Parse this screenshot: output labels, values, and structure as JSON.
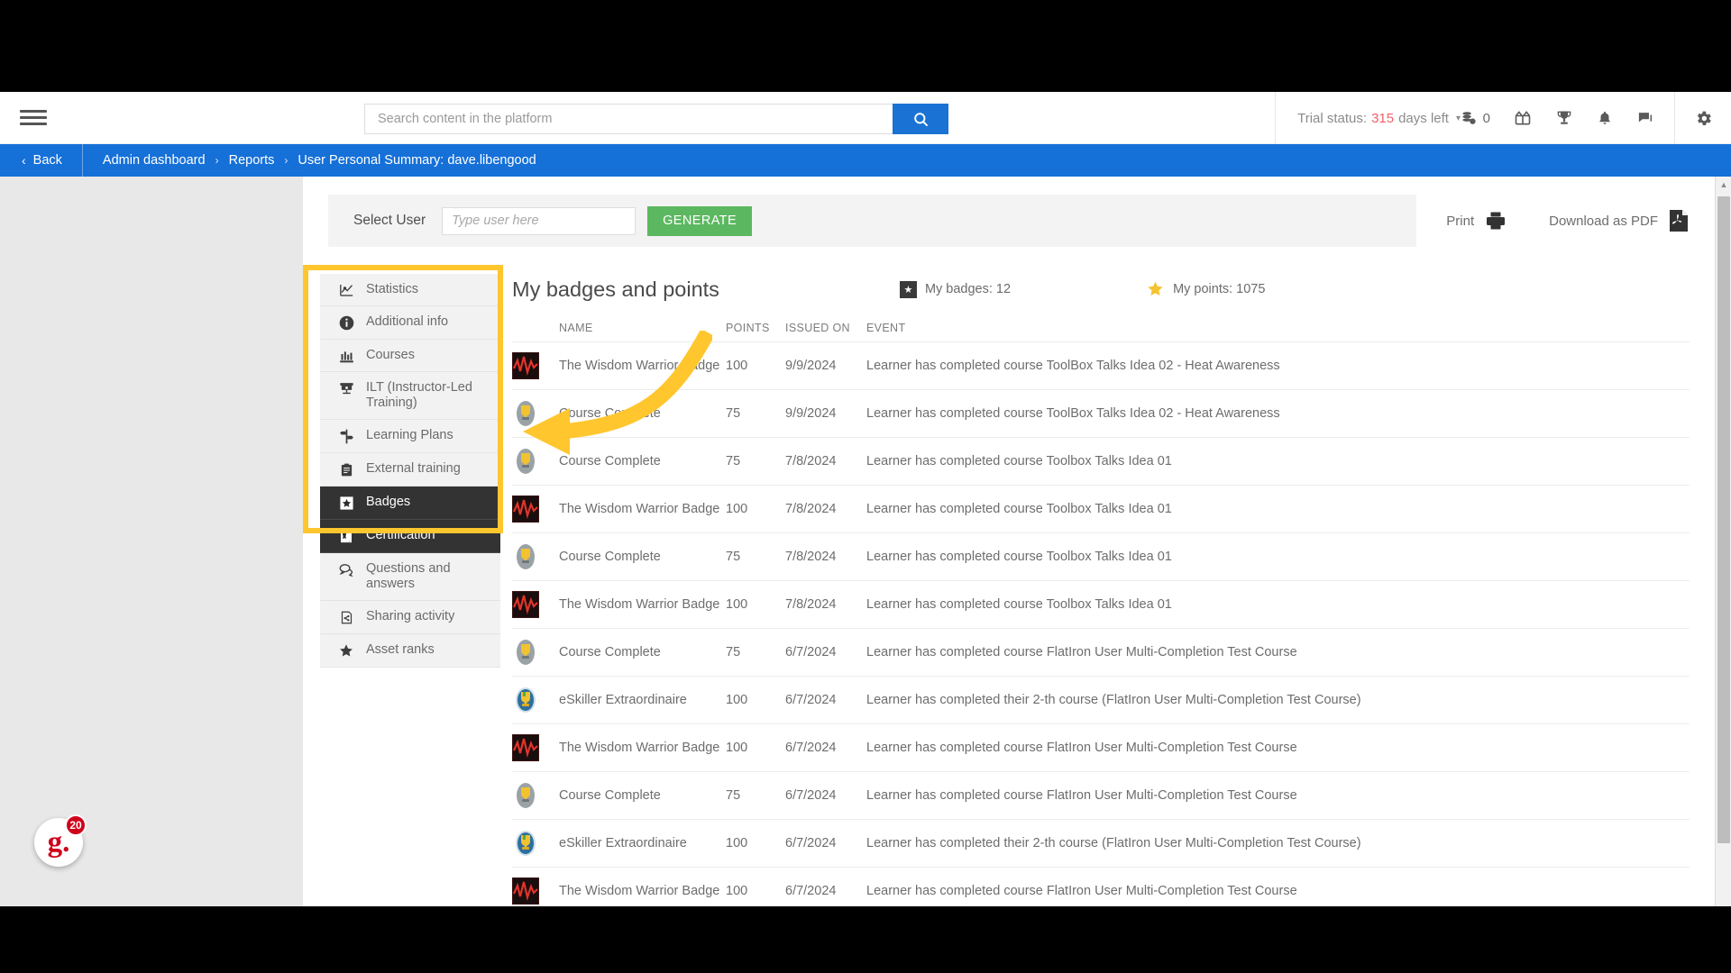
{
  "topbar": {
    "menu_icon": "hamburger-icon",
    "search_placeholder": "Search content in the platform",
    "search_value": "",
    "search_icon": "search-icon",
    "trial_prefix": "Trial status:",
    "trial_days": "315",
    "trial_suffix": "days left",
    "trial_caret": "▾",
    "coins_count": "0",
    "icons": [
      "coins-icon",
      "gift-icon",
      "trophy-icon",
      "bell-icon",
      "chat-icon",
      "gear-icon"
    ]
  },
  "breadcrumb": {
    "back_label": "Back",
    "back_chevron": "‹",
    "separator": "›",
    "items": [
      {
        "label": "Admin dashboard"
      },
      {
        "label": "Reports"
      },
      {
        "label": "User Personal Summary: dave.libengood"
      }
    ]
  },
  "toolbar": {
    "select_user_label": "Select User",
    "user_placeholder": "Type user here",
    "user_value": "",
    "generate_label": "GENERATE",
    "print_label": "Print",
    "print_icon": "printer-icon",
    "download_label": "Download as PDF",
    "download_icon": "pdf-icon"
  },
  "sidemenu": {
    "items": [
      {
        "label": "Statistics",
        "icon": "chart-line-icon",
        "active": false
      },
      {
        "label": "Additional info",
        "icon": "info-circle-icon",
        "active": false
      },
      {
        "label": "Courses",
        "icon": "bar-chart-icon",
        "active": false
      },
      {
        "label": "ILT (Instructor-Led Training)",
        "icon": "projector-icon",
        "active": false
      },
      {
        "label": "Learning Plans",
        "icon": "signpost-icon",
        "active": false
      },
      {
        "label": "External training",
        "icon": "clipboard-icon",
        "active": false
      },
      {
        "label": "Badges",
        "icon": "star-square-icon",
        "active": true
      },
      {
        "label": "Certification",
        "icon": "certificate-icon",
        "active": true
      },
      {
        "label": "Questions and answers",
        "icon": "speech-bubble-icon",
        "active": false
      },
      {
        "label": "Sharing activity",
        "icon": "share-file-icon",
        "active": false
      },
      {
        "label": "Asset ranks",
        "icon": "star-icon",
        "active": false
      }
    ]
  },
  "badges_panel": {
    "title": "My badges and points",
    "my_badges_label": "My badges: 12",
    "my_points_label": "My points: 1075",
    "badge_icon": "square-star-icon",
    "points_icon": "gold-star-icon",
    "columns": [
      "NAME",
      "POINTS",
      "ISSUED ON",
      "EVENT"
    ],
    "rows": [
      {
        "icon": "wisdom-warrior-badge-icon",
        "name": "The Wisdom Warrior Badge",
        "points": "100",
        "issued_on": "9/9/2024",
        "event": "Learner has completed course ToolBox Talks Idea 02 - Heat Awareness"
      },
      {
        "icon": "course-complete-badge-icon",
        "name": "Course Complete",
        "points": "75",
        "issued_on": "9/9/2024",
        "event": "Learner has completed course ToolBox Talks Idea 02 - Heat Awareness"
      },
      {
        "icon": "course-complete-badge-icon",
        "name": "Course Complete",
        "points": "75",
        "issued_on": "7/8/2024",
        "event": "Learner has completed course Toolbox Talks Idea 01"
      },
      {
        "icon": "wisdom-warrior-badge-icon",
        "name": "The Wisdom Warrior Badge",
        "points": "100",
        "issued_on": "7/8/2024",
        "event": "Learner has completed course Toolbox Talks Idea 01"
      },
      {
        "icon": "course-complete-badge-icon",
        "name": "Course Complete",
        "points": "75",
        "issued_on": "7/8/2024",
        "event": "Learner has completed course Toolbox Talks Idea 01"
      },
      {
        "icon": "wisdom-warrior-badge-icon",
        "name": "The Wisdom Warrior Badge",
        "points": "100",
        "issued_on": "7/8/2024",
        "event": "Learner has completed course Toolbox Talks Idea 01"
      },
      {
        "icon": "course-complete-badge-icon",
        "name": "Course Complete",
        "points": "75",
        "issued_on": "6/7/2024",
        "event": "Learner has completed course FlatIron User Multi-Completion Test Course"
      },
      {
        "icon": "eskiller-badge-icon",
        "name": "eSkiller Extraordinaire",
        "points": "100",
        "issued_on": "6/7/2024",
        "event": "Learner has completed their 2-th course (FlatIron User Multi-Completion Test Course)"
      },
      {
        "icon": "wisdom-warrior-badge-icon",
        "name": "The Wisdom Warrior Badge",
        "points": "100",
        "issued_on": "6/7/2024",
        "event": "Learner has completed course FlatIron User Multi-Completion Test Course"
      },
      {
        "icon": "course-complete-badge-icon",
        "name": "Course Complete",
        "points": "75",
        "issued_on": "6/7/2024",
        "event": "Learner has completed course FlatIron User Multi-Completion Test Course"
      },
      {
        "icon": "eskiller-badge-icon",
        "name": "eSkiller Extraordinaire",
        "points": "100",
        "issued_on": "6/7/2024",
        "event": "Learner has completed their 2-th course (FlatIron User Multi-Completion Test Course)"
      },
      {
        "icon": "wisdom-warrior-badge-icon",
        "name": "The Wisdom Warrior Badge",
        "points": "100",
        "issued_on": "6/7/2024",
        "event": "Learner has completed course FlatIron User Multi-Completion Test Course"
      }
    ]
  },
  "help_widget": {
    "logo_text": "g.",
    "count": "20"
  },
  "colors": {
    "brand_blue": "#1570d8",
    "accent_green": "#5cb860",
    "highlight_yellow": "#ffc62e",
    "trial_red": "#f0606b",
    "logo_red": "#d0021b"
  }
}
